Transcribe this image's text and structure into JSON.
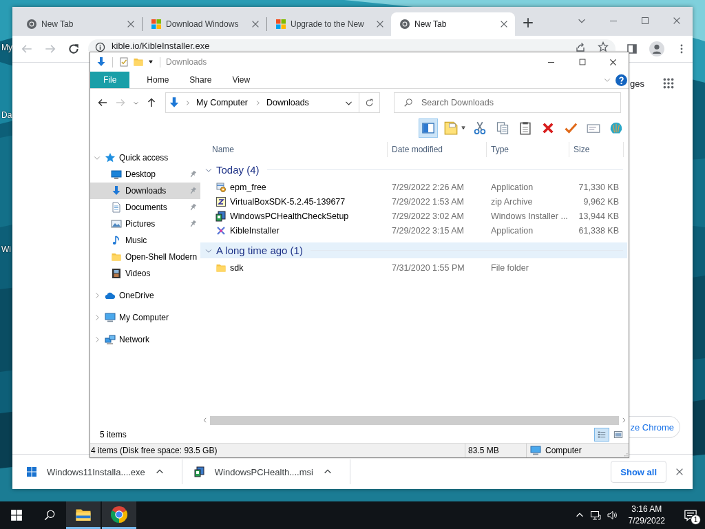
{
  "desktop": {
    "icons": [
      {
        "label": "My"
      },
      {
        "label": "Da"
      },
      {
        "label": "Wi"
      }
    ]
  },
  "browser": {
    "tabs": [
      {
        "title": "New Tab",
        "kind": "chrome",
        "selected": false
      },
      {
        "title": "Download Windows",
        "kind": "windows",
        "selected": false
      },
      {
        "title": "Upgrade to the New",
        "kind": "windows",
        "selected": false
      },
      {
        "title": "New Tab",
        "kind": "chrome",
        "selected": true
      }
    ],
    "nav": {
      "back_enabled": false,
      "forward_enabled": false
    },
    "address": "kible.io/KibleInstaller.exe",
    "page": {
      "link": "ges",
      "button": "ze Chrome"
    },
    "downloads": [
      {
        "name": "Windows11Installa....exe",
        "kind": "windows"
      },
      {
        "name": "WindowsPCHealth....msi",
        "kind": "installer"
      }
    ],
    "show_all": "Show all"
  },
  "explorer": {
    "title": "Downloads",
    "ribbon_tabs": [
      {
        "label": "File",
        "selected": true
      },
      {
        "label": "Home",
        "selected": false
      },
      {
        "label": "Share",
        "selected": false
      },
      {
        "label": "View",
        "selected": false
      }
    ],
    "nav": {
      "back_enabled": true,
      "forward_enabled": false
    },
    "path": [
      "My Computer",
      "Downloads"
    ],
    "search": {
      "placeholder": "Search Downloads"
    },
    "toolbar": [
      {
        "kind": "panes",
        "on": true
      },
      {
        "kind": "properties",
        "on": false
      },
      {
        "kind": "cut",
        "on": false
      },
      {
        "kind": "copy",
        "on": false
      },
      {
        "kind": "paste",
        "on": false
      },
      {
        "kind": "delete",
        "on": false
      },
      {
        "kind": "check",
        "on": false
      },
      {
        "kind": "rename",
        "on": false
      },
      {
        "kind": "shell",
        "on": false
      }
    ],
    "sidebar": [
      {
        "label": "Quick access",
        "kind": "star",
        "expanded": true,
        "selected": false,
        "children": [
          {
            "label": "Desktop",
            "kind": "desktop",
            "pinned": true,
            "selected": false
          },
          {
            "label": "Downloads",
            "kind": "download",
            "pinned": true,
            "selected": true
          },
          {
            "label": "Documents",
            "kind": "document",
            "pinned": true,
            "selected": false
          },
          {
            "label": "Pictures",
            "kind": "pictures",
            "pinned": true,
            "selected": false
          },
          {
            "label": "Music",
            "kind": "music",
            "pinned": false,
            "selected": false
          },
          {
            "label": "Open-Shell Modern",
            "kind": "folder",
            "pinned": false,
            "selected": false
          },
          {
            "label": "Videos",
            "kind": "video",
            "pinned": false,
            "selected": false
          }
        ]
      },
      {
        "label": "OneDrive",
        "kind": "cloud",
        "expanded": false,
        "selected": false
      },
      {
        "label": "My Computer",
        "kind": "computer",
        "expanded": false,
        "selected": false
      },
      {
        "label": "Network",
        "kind": "network",
        "expanded": false,
        "selected": false
      }
    ],
    "columns": [
      "Name",
      "Date modified",
      "Type",
      "Size"
    ],
    "groups": [
      {
        "label": "Today (4)",
        "expanded": true,
        "selected": false,
        "files": [
          {
            "name": "epm_free",
            "date": "7/29/2022 2:26 AM",
            "type": "Application",
            "size": "71,330 KB",
            "kind": "setup"
          },
          {
            "name": "VirtualBoxSDK-5.2.45-139677",
            "date": "7/29/2022 1:53 AM",
            "type": "zip Archive",
            "size": "9,962 KB",
            "kind": "zip"
          },
          {
            "name": "WindowsPCHealthCheckSetup",
            "date": "7/29/2022 3:02 AM",
            "type": "Windows Installer ...",
            "size": "13,944 KB",
            "kind": "installer"
          },
          {
            "name": "KibleInstaller",
            "date": "7/29/2022 3:15 AM",
            "type": "Application",
            "size": "61,338 KB",
            "kind": "app"
          }
        ]
      },
      {
        "label": "A long time ago (1)",
        "expanded": true,
        "selected": true,
        "files": [
          {
            "name": "sdk",
            "date": "7/31/2020 1:55 PM",
            "type": "File folder",
            "kind": "folder"
          }
        ]
      }
    ],
    "item_count": "5 items",
    "views": [
      {
        "kind": "details",
        "selected": true
      },
      {
        "kind": "tiles",
        "selected": false
      }
    ],
    "status": {
      "text": "4 items (Disk free space: 93.5 GB)",
      "size": "83.5 MB",
      "location": "Computer"
    }
  },
  "taskbar": {
    "apps": [
      {
        "kind": "explorer",
        "running": true
      },
      {
        "kind": "chrome",
        "running": true
      }
    ],
    "time": "3:16 AM",
    "date": "7/29/2022",
    "notifications": "1"
  }
}
